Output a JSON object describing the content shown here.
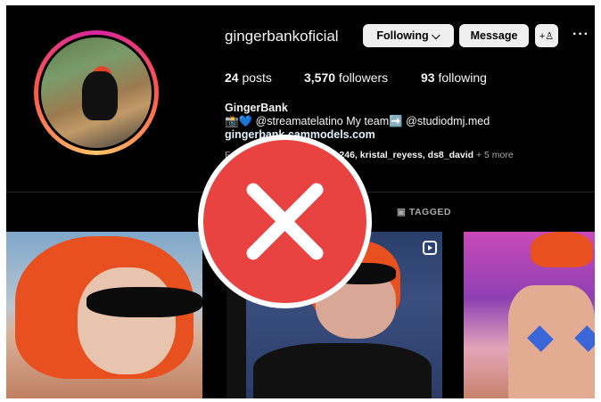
{
  "profile": {
    "username": "gingerbankoficial",
    "full_name": "GingerBank",
    "bio": "📸💙 @streamatelatino My team➡️ @studiodmj.med",
    "website": "gingerbank.cammodels.com",
    "followed_by_prefix": "F",
    "followed_by_names": "246, kristal_reyess, ds8_david",
    "followed_by_more": " + 5 more"
  },
  "stats": {
    "posts_count": "24",
    "posts_label": " posts",
    "followers_count": "3,570",
    "followers_label": " followers",
    "following_count": "93",
    "following_label": " following"
  },
  "actions": {
    "following_label": "Following ⌵",
    "message_label": "Message",
    "add_user_label": "+♙",
    "more_label": "···"
  },
  "tabs": {
    "tagged_label": "TAGGED"
  },
  "icons": {
    "tagged": "person-tag-icon",
    "reel": "reel-icon",
    "overlay": "red-x-icon"
  },
  "colors": {
    "background": "#000000",
    "button_bg": "#efefef",
    "overlay_red": "#e84340"
  }
}
